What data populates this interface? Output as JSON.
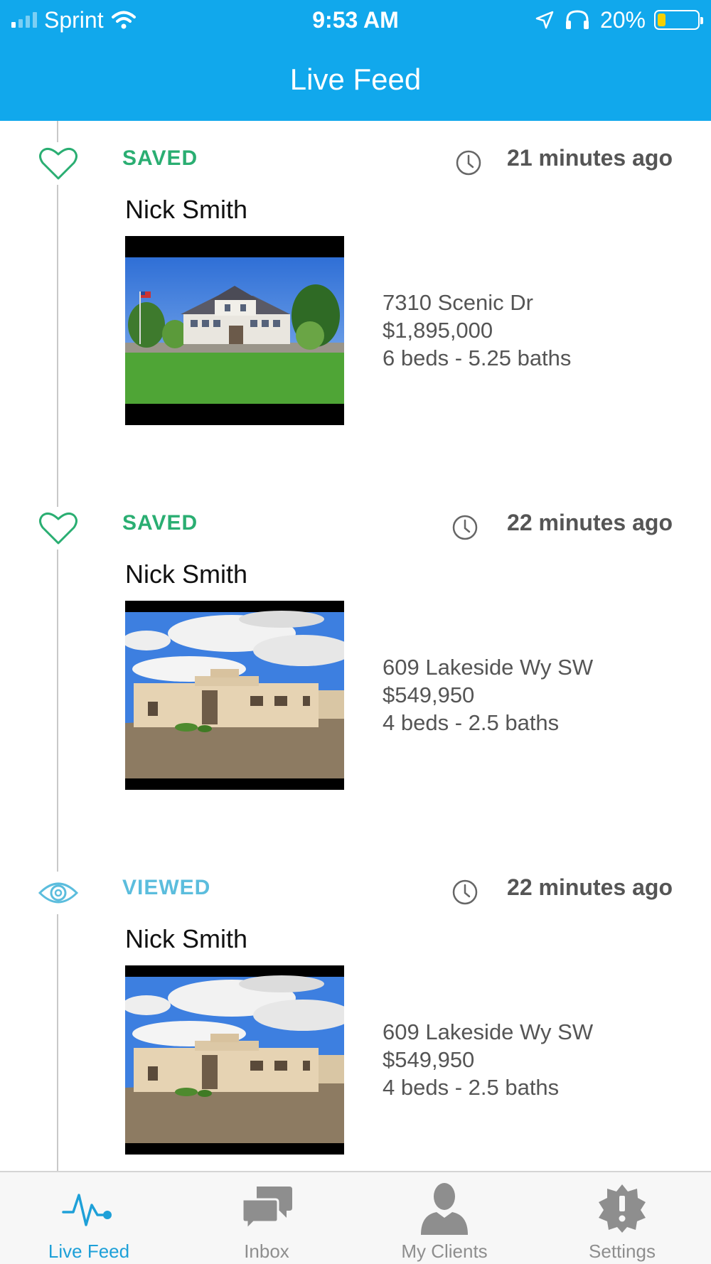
{
  "status_bar": {
    "carrier": "Sprint",
    "time": "9:53 AM",
    "battery_text": "20%",
    "battery_level": 0.2,
    "signal_bars": 4,
    "signal_bars_active": 1,
    "battery_color": "#f7d000"
  },
  "header": {
    "title": "Live Feed",
    "background_color": "#11a8ec"
  },
  "feed": {
    "items": [
      {
        "status": "SAVED",
        "status_type": "saved",
        "icon": "heart-icon",
        "time": "21 minutes ago",
        "name": "Nick Smith",
        "photo": "craftsman-house-photo",
        "address": "7310 Scenic Dr",
        "price": "$1,895,000",
        "beds_baths": "6 beds - 5.25 baths"
      },
      {
        "status": "SAVED",
        "status_type": "saved",
        "icon": "heart-icon",
        "time": "22 minutes ago",
        "name": "Nick Smith",
        "photo": "adobe-house-photo",
        "address": "609 Lakeside Wy SW",
        "price": "$549,950",
        "beds_baths": "4 beds - 2.5 baths"
      },
      {
        "status": "VIEWED",
        "status_type": "viewed",
        "icon": "eye-icon",
        "time": "22 minutes ago",
        "name": "Nick Smith",
        "photo": "adobe-house-photo",
        "address": "609 Lakeside Wy SW",
        "price": "$549,950",
        "beds_baths": "4 beds - 2.5 baths"
      }
    ],
    "colors": {
      "saved": "#2aae72",
      "viewed": "#5bbddd"
    }
  },
  "tabbar": {
    "tabs": [
      {
        "label": "Live Feed",
        "icon": "pulse-icon",
        "active": true
      },
      {
        "label": "Inbox",
        "icon": "chat-bubbles-icon",
        "active": false
      },
      {
        "label": "My Clients",
        "icon": "person-icon",
        "active": false
      },
      {
        "label": "Settings",
        "icon": "gear-alert-icon",
        "active": false
      }
    ],
    "active_color": "#1ea0d8",
    "inactive_color": "#8e8e8e"
  }
}
